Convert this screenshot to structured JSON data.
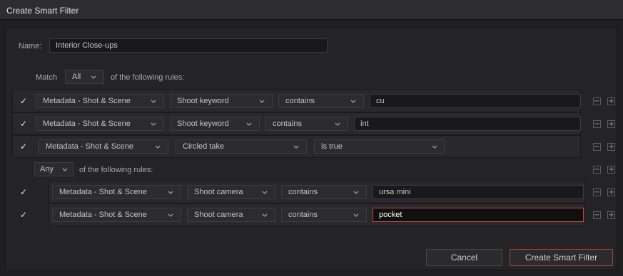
{
  "dialog": {
    "title": "Create Smart Filter"
  },
  "name": {
    "label": "Name:",
    "value": "Interior Close-ups"
  },
  "match": {
    "prefix": "Match",
    "value": "All",
    "suffix": "of the following rules:"
  },
  "rules": [
    {
      "checked": true,
      "category": "Metadata - Shot & Scene",
      "field": "Shoot keyword",
      "operator": "contains",
      "value": "cu"
    },
    {
      "checked": true,
      "category": "Metadata - Shot & Scene",
      "field": "Shoot keyword",
      "operator": "contains",
      "value": "int"
    },
    {
      "checked": true,
      "category": "Metadata - Shot & Scene",
      "field": "Circled take",
      "operator": "is true"
    }
  ],
  "nested": {
    "match_value": "Any",
    "suffix": "of the following rules:",
    "rules": [
      {
        "checked": true,
        "category": "Metadata - Shot & Scene",
        "field": "Shoot camera",
        "operator": "contains",
        "value": "ursa mini"
      },
      {
        "checked": true,
        "category": "Metadata - Shot & Scene",
        "field": "Shoot camera",
        "operator": "contains",
        "value": "pocket"
      }
    ]
  },
  "controls": {
    "minus": "−",
    "plus": "+",
    "check": "✓"
  },
  "buttons": {
    "cancel": "Cancel",
    "create": "Create Smart Filter"
  },
  "colors": {
    "accent": "#c4453a",
    "background": "#242427"
  }
}
